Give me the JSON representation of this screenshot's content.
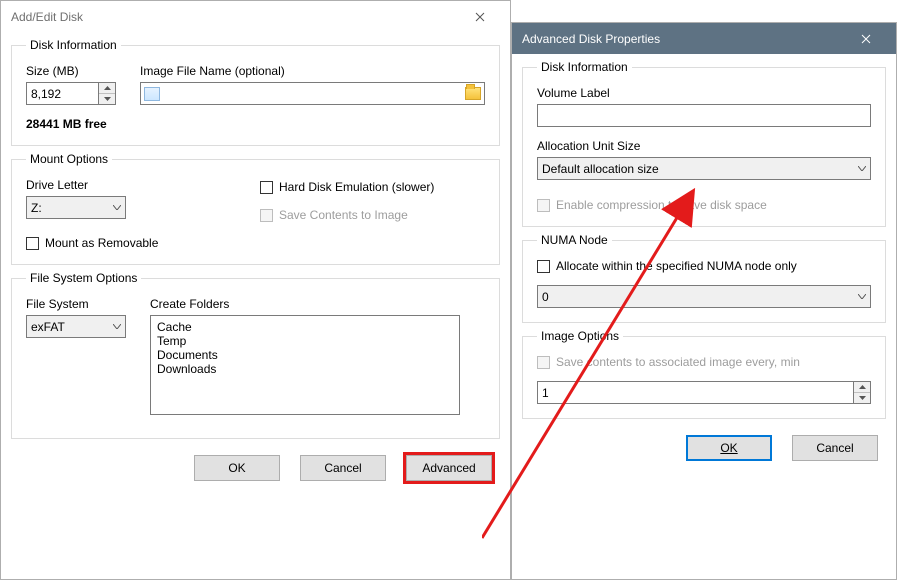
{
  "dlg1": {
    "title": "Add/Edit Disk",
    "disk_info": {
      "legend": "Disk Information",
      "size_label": "Size (MB)",
      "size_value": "8,192",
      "image_label": "Image File Name (optional)",
      "free_text": "28441 MB free"
    },
    "mount": {
      "legend": "Mount Options",
      "drive_letter_label": "Drive Letter",
      "drive_letter_value": "Z:",
      "hdd_emu": "Hard Disk Emulation (slower)",
      "save_contents": "Save Contents to Image",
      "removable": "Mount as Removable"
    },
    "fs": {
      "legend": "File System Options",
      "fs_label": "File System",
      "fs_value": "exFAT",
      "folders_label": "Create Folders",
      "folders_value": "Cache\nTemp\nDocuments\nDownloads"
    },
    "buttons": {
      "ok": "OK",
      "cancel": "Cancel",
      "advanced": "Advanced"
    }
  },
  "dlg2": {
    "title": "Advanced Disk Properties",
    "disk_info": {
      "legend": "Disk Information",
      "volume_label_label": "Volume Label",
      "volume_label_value": "",
      "alloc_label": "Allocation Unit Size",
      "alloc_value": "Default allocation size",
      "compress": "Enable compression to save disk space"
    },
    "numa": {
      "legend": "NUMA Node",
      "allocate_label": "Allocate within the specified NUMA node only",
      "node_value": "0"
    },
    "image": {
      "legend": "Image Options",
      "save_every": "Save contents to associated image every, min",
      "min_value": "1"
    },
    "buttons": {
      "ok": "OK",
      "cancel": "Cancel"
    }
  }
}
